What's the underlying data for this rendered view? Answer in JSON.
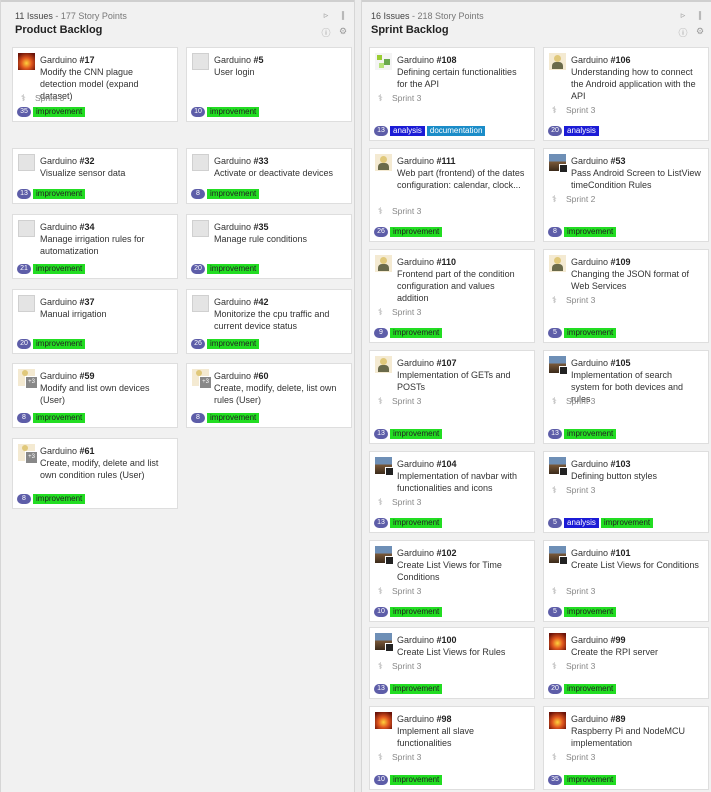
{
  "columns": [
    {
      "id": "product",
      "issues_count": "11 Issues",
      "story_points": "177 Story Points",
      "title": "Product Backlog",
      "cards": [
        {
          "owner": "Garduino",
          "num": "#17",
          "title": "Modify the CNN plague detection model (expand dataset)",
          "sprint": "Sprint 3",
          "points": "35",
          "tags": [
            "improvement"
          ],
          "avatar": "fire"
        },
        {
          "owner": "Garduino",
          "num": "#5",
          "title": "User login",
          "sprint": "",
          "points": "10",
          "tags": [
            "improvement"
          ],
          "avatar": "blank"
        },
        {
          "owner": "Garduino",
          "num": "#32",
          "title": "Visualize sensor data",
          "sprint": "",
          "points": "13",
          "tags": [
            "improvement"
          ],
          "avatar": "blank"
        },
        {
          "owner": "Garduino",
          "num": "#33",
          "title": "Activate or deactivate devices",
          "sprint": "",
          "points": "8",
          "tags": [
            "improvement"
          ],
          "avatar": "blank"
        },
        {
          "owner": "Garduino",
          "num": "#34",
          "title": "Manage irrigation rules for automatization",
          "sprint": "",
          "points": "21",
          "tags": [
            "improvement"
          ],
          "avatar": "blank"
        },
        {
          "owner": "Garduino",
          "num": "#35",
          "title": "Manage rule conditions",
          "sprint": "",
          "points": "20",
          "tags": [
            "improvement"
          ],
          "avatar": "blank"
        },
        {
          "owner": "Garduino",
          "num": "#37",
          "title": "Manual irrigation",
          "sprint": "",
          "points": "20",
          "tags": [
            "improvement"
          ],
          "avatar": "blank"
        },
        {
          "owner": "Garduino",
          "num": "#42",
          "title": "Monitorize the cpu traffic and current device status",
          "sprint": "",
          "points": "26",
          "tags": [
            "improvement"
          ],
          "avatar": "blank"
        },
        {
          "owner": "Garduino",
          "num": "#59",
          "title": "Modify and list own devices (User)",
          "sprint": "",
          "points": "8",
          "tags": [
            "improvement"
          ],
          "avatar": "multi"
        },
        {
          "owner": "Garduino",
          "num": "#60",
          "title": "Create, modify, delete, list own rules (User)",
          "sprint": "",
          "points": "8",
          "tags": [
            "improvement"
          ],
          "avatar": "multi"
        },
        {
          "owner": "Garduino",
          "num": "#61",
          "title": "Create, modify, delete and list own condition rules (User)",
          "sprint": "",
          "points": "8",
          "tags": [
            "improvement"
          ],
          "avatar": "multi"
        }
      ]
    },
    {
      "id": "sprint",
      "issues_count": "16 Issues",
      "story_points": "218 Story Points",
      "title": "Sprint Backlog",
      "cards": [
        {
          "owner": "Garduino",
          "num": "#108",
          "title": "Defining certain functionalities for the API",
          "sprint": "Sprint 3",
          "points": "13",
          "tags": [
            "analysis",
            "documentation"
          ],
          "avatar": "pixel"
        },
        {
          "owner": "Garduino",
          "num": "#106",
          "title": "Understanding how to connect the Android application with the API",
          "sprint": "Sprint 3",
          "points": "20",
          "tags": [
            "analysis"
          ],
          "avatar": "person"
        },
        {
          "owner": "Garduino",
          "num": "#111",
          "title": "Web part (frontend) of the dates configuration: calendar, clock...",
          "sprint": "Sprint 3",
          "points": "26",
          "tags": [
            "improvement"
          ],
          "avatar": "person"
        },
        {
          "owner": "Garduino",
          "num": "#53",
          "title": "Pass Android Screen to ListView timeCondition Rules",
          "sprint": "Sprint 2",
          "points": "8",
          "tags": [
            "improvement"
          ],
          "avatar": "photo"
        },
        {
          "owner": "Garduino",
          "num": "#110",
          "title": "Frontend part of the condition configuration and values addition",
          "sprint": "Sprint 3",
          "points": "9",
          "tags": [
            "improvement"
          ],
          "avatar": "person"
        },
        {
          "owner": "Garduino",
          "num": "#109",
          "title": "Changing the JSON format of Web Services",
          "sprint": "Sprint 3",
          "points": "5",
          "tags": [
            "improvement"
          ],
          "avatar": "person"
        },
        {
          "owner": "Garduino",
          "num": "#107",
          "title": "Implementation of GETs and POSTs",
          "sprint": "Sprint 3",
          "points": "13",
          "tags": [
            "improvement"
          ],
          "avatar": "person"
        },
        {
          "owner": "Garduino",
          "num": "#105",
          "title": "Implementation of search system for both devices and rules",
          "sprint": "Sprint 3",
          "points": "13",
          "tags": [
            "improvement"
          ],
          "avatar": "photo"
        },
        {
          "owner": "Garduino",
          "num": "#104",
          "title": "Implementation of navbar with functionalities and icons",
          "sprint": "Sprint 3",
          "points": "13",
          "tags": [
            "improvement"
          ],
          "avatar": "photo"
        },
        {
          "owner": "Garduino",
          "num": "#103",
          "title": "Defining button styles",
          "sprint": "Sprint 3",
          "points": "5",
          "tags": [
            "analysis",
            "improvement"
          ],
          "avatar": "photo"
        },
        {
          "owner": "Garduino",
          "num": "#102",
          "title": "Create List Views for Time Conditions",
          "sprint": "Sprint 3",
          "points": "10",
          "tags": [
            "improvement"
          ],
          "avatar": "photo"
        },
        {
          "owner": "Garduino",
          "num": "#101",
          "title": "Create List Views for Conditions",
          "sprint": "Sprint 3",
          "points": "5",
          "tags": [
            "improvement"
          ],
          "avatar": "photo"
        },
        {
          "owner": "Garduino",
          "num": "#100",
          "title": "Create List Views for Rules",
          "sprint": "Sprint 3",
          "points": "13",
          "tags": [
            "improvement"
          ],
          "avatar": "photo"
        },
        {
          "owner": "Garduino",
          "num": "#99",
          "title": "Create the RPI server",
          "sprint": "Sprint 3",
          "points": "20",
          "tags": [
            "improvement"
          ],
          "avatar": "fire"
        },
        {
          "owner": "Garduino",
          "num": "#98",
          "title": "Implement all slave functionalities",
          "sprint": "Sprint 3",
          "points": "10",
          "tags": [
            "improvement"
          ],
          "avatar": "fire"
        },
        {
          "owner": "Garduino",
          "num": "#89",
          "title": "Raspberry Pi and NodeMCU implementation",
          "sprint": "Sprint 3",
          "points": "35",
          "tags": [
            "improvement"
          ],
          "avatar": "fire"
        }
      ]
    }
  ]
}
